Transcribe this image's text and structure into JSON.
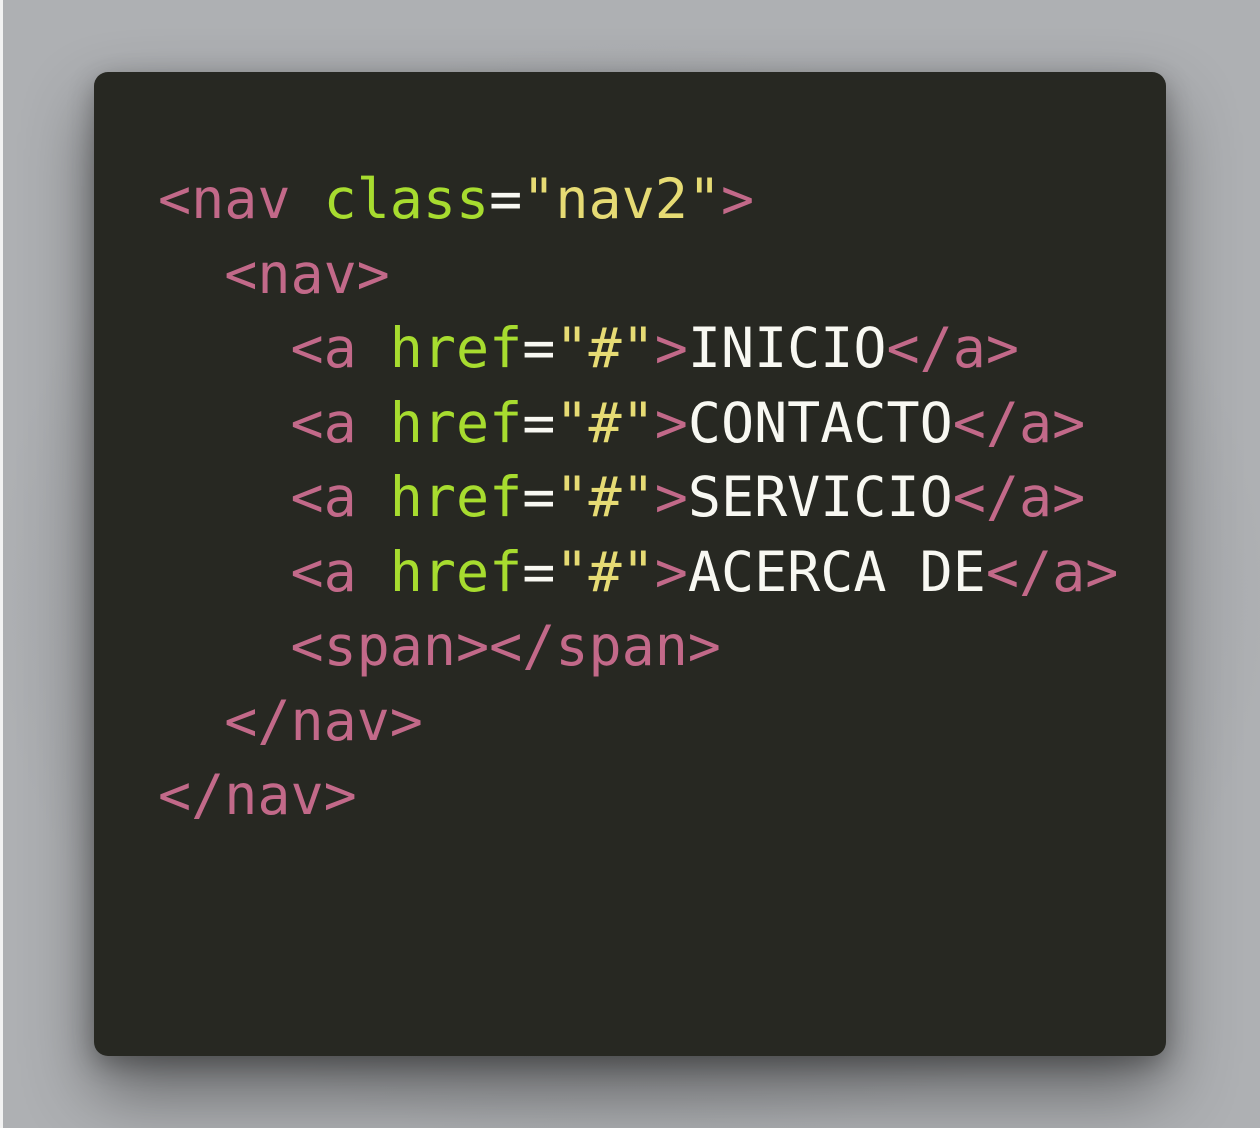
{
  "colors": {
    "background": "#a9abae",
    "editor_background": "#272822",
    "tag": "#c26989",
    "attribute": "#a7dc2f",
    "string": "#e6db74",
    "text": "#f8f8f2"
  },
  "code_lines": [
    {
      "indent": "",
      "tokens": [
        {
          "t": "tag",
          "v": "<nav "
        },
        {
          "t": "attr",
          "v": "class"
        },
        {
          "t": "eq",
          "v": "="
        },
        {
          "t": "str",
          "v": "\"nav2\""
        },
        {
          "t": "tag",
          "v": ">"
        }
      ]
    },
    {
      "indent": "  ",
      "tokens": [
        {
          "t": "tag",
          "v": "<nav>"
        }
      ]
    },
    {
      "indent": "    ",
      "tokens": [
        {
          "t": "tag",
          "v": "<a "
        },
        {
          "t": "attr",
          "v": "href"
        },
        {
          "t": "eq",
          "v": "="
        },
        {
          "t": "str",
          "v": "\"#\""
        },
        {
          "t": "tag",
          "v": ">"
        },
        {
          "t": "txt",
          "v": "INICIO"
        },
        {
          "t": "tag",
          "v": "</a>"
        }
      ]
    },
    {
      "indent": "    ",
      "tokens": [
        {
          "t": "tag",
          "v": "<a "
        },
        {
          "t": "attr",
          "v": "href"
        },
        {
          "t": "eq",
          "v": "="
        },
        {
          "t": "str",
          "v": "\"#\""
        },
        {
          "t": "tag",
          "v": ">"
        },
        {
          "t": "txt",
          "v": "CONTACTO"
        },
        {
          "t": "tag",
          "v": "</a>"
        }
      ]
    },
    {
      "indent": "    ",
      "tokens": [
        {
          "t": "tag",
          "v": "<a "
        },
        {
          "t": "attr",
          "v": "href"
        },
        {
          "t": "eq",
          "v": "="
        },
        {
          "t": "str",
          "v": "\"#\""
        },
        {
          "t": "tag",
          "v": ">"
        },
        {
          "t": "txt",
          "v": "SERVICIO"
        },
        {
          "t": "tag",
          "v": "</a>"
        }
      ]
    },
    {
      "indent": "    ",
      "tokens": [
        {
          "t": "tag",
          "v": "<a "
        },
        {
          "t": "attr",
          "v": "href"
        },
        {
          "t": "eq",
          "v": "="
        },
        {
          "t": "str",
          "v": "\"#\""
        },
        {
          "t": "tag",
          "v": ">"
        },
        {
          "t": "txt",
          "v": "ACERCA DE"
        },
        {
          "t": "tag",
          "v": "</a>"
        }
      ]
    },
    {
      "indent": "    ",
      "tokens": [
        {
          "t": "tag",
          "v": "<span></span>"
        }
      ]
    },
    {
      "indent": "  ",
      "tokens": [
        {
          "t": "tag",
          "v": "</nav>"
        }
      ]
    },
    {
      "indent": "",
      "tokens": [
        {
          "t": "tag",
          "v": "</nav>"
        }
      ]
    }
  ]
}
